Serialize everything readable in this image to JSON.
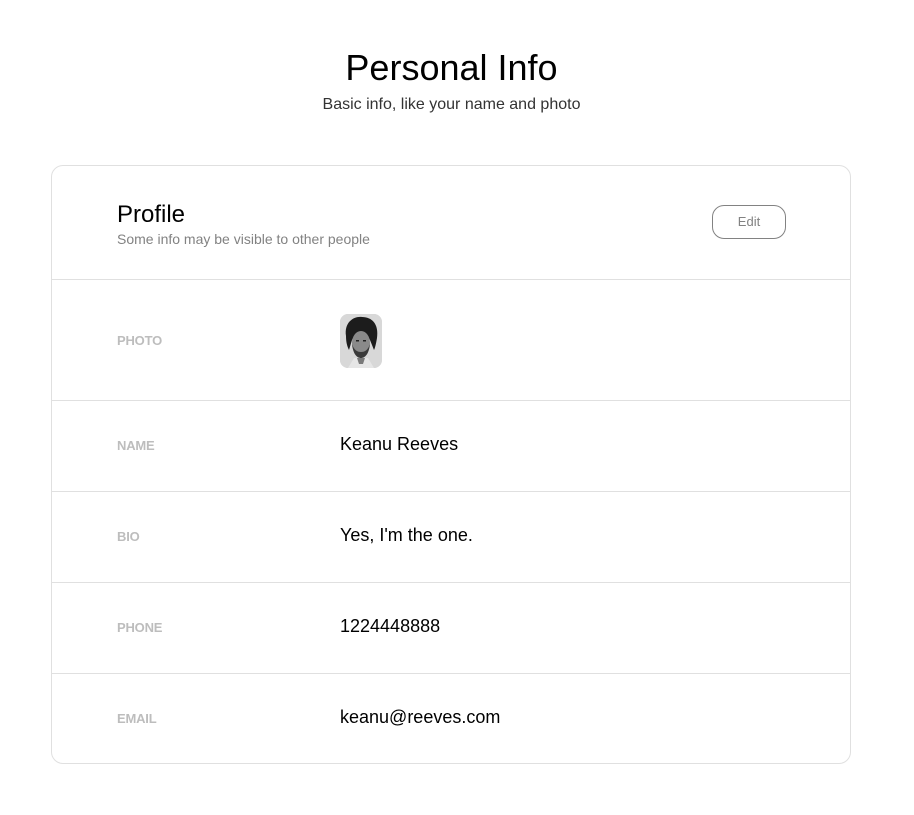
{
  "header": {
    "title": "Personal Info",
    "subtitle": "Basic info, like your name and photo"
  },
  "profile": {
    "title": "Profile",
    "subtitle": "Some info may be visible to other people",
    "edit_label": "Edit"
  },
  "rows": {
    "photo": {
      "label": "PHOTO"
    },
    "name": {
      "label": "NAME",
      "value": "Keanu Reeves"
    },
    "bio": {
      "label": "BIO",
      "value": "Yes, I'm the one."
    },
    "phone": {
      "label": "PHONE",
      "value": "1224448888"
    },
    "email": {
      "label": "EMAIL",
      "value": "keanu@reeves.com"
    }
  },
  "colors": {
    "border": "#e0e0e0",
    "label": "#bdbdbd",
    "muted": "#828282"
  }
}
